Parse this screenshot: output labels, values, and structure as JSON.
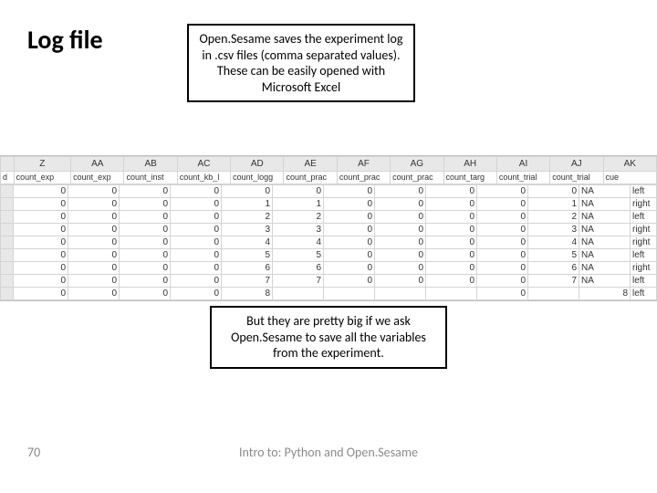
{
  "title": "Log file",
  "callout_top": "Open.Sesame saves the experiment log in .csv files (comma separated values). These can be easily opened with Microsoft Excel",
  "callout_bottom": "But they are pretty big if we ask Open.Sesame to save all the variables from the experiment.",
  "spreadsheet": {
    "col_letters": [
      "",
      "Z",
      "AA",
      "AB",
      "AC",
      "AD",
      "AE",
      "AF",
      "AG",
      "AH",
      "AI",
      "AJ",
      "AK"
    ],
    "field_row": [
      "d",
      "count_exp",
      "count_exp",
      "count_inst",
      "count_kb_l",
      "count_logg",
      "count_prac",
      "count_prac",
      "count_prac",
      "count_targ",
      "count_trial",
      "count_trial",
      "cue"
    ],
    "rows": [
      [
        "0",
        "0",
        "0",
        "0",
        "0",
        "0",
        "0",
        "0",
        "0",
        "0",
        "0",
        "NA",
        "left"
      ],
      [
        "0",
        "0",
        "0",
        "0",
        "1",
        "1",
        "0",
        "0",
        "0",
        "0",
        "1",
        "NA",
        "right"
      ],
      [
        "0",
        "0",
        "0",
        "0",
        "2",
        "2",
        "0",
        "0",
        "0",
        "0",
        "2",
        "NA",
        "left"
      ],
      [
        "0",
        "0",
        "0",
        "0",
        "3",
        "3",
        "0",
        "0",
        "0",
        "0",
        "3",
        "NA",
        "right"
      ],
      [
        "0",
        "0",
        "0",
        "0",
        "4",
        "4",
        "0",
        "0",
        "0",
        "0",
        "4",
        "NA",
        "right"
      ],
      [
        "0",
        "0",
        "0",
        "0",
        "5",
        "5",
        "0",
        "0",
        "0",
        "0",
        "5",
        "NA",
        "left"
      ],
      [
        "0",
        "0",
        "0",
        "0",
        "6",
        "6",
        "0",
        "0",
        "0",
        "0",
        "6",
        "NA",
        "right"
      ],
      [
        "0",
        "0",
        "0",
        "0",
        "7",
        "7",
        "0",
        "0",
        "0",
        "0",
        "7",
        "NA",
        "left"
      ],
      [
        "0",
        "0",
        "0",
        "0",
        "8",
        "",
        "",
        "",
        "",
        "0",
        "",
        "8",
        "left"
      ]
    ]
  },
  "footer": {
    "page": "70",
    "caption": "Intro to: Python and Open.Sesame"
  }
}
